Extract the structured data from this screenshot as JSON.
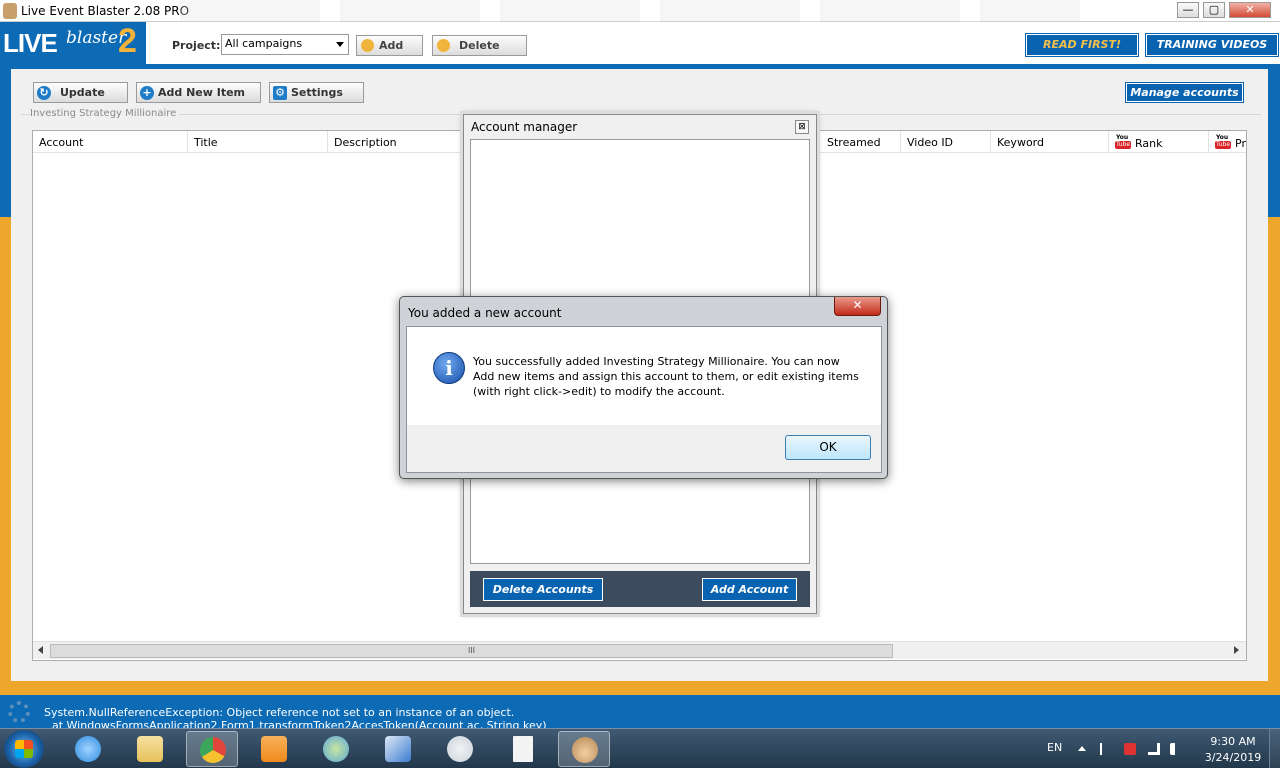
{
  "window": {
    "title": "Live Event Blaster 2.08 PRO",
    "controls": {
      "minimize": "—",
      "maximize": "▢",
      "close": "✕"
    }
  },
  "logo": {
    "live": "LIVE",
    "blaster": "blaster",
    "version": "2"
  },
  "header": {
    "project_label": "Project:",
    "project_value": "All campaigns",
    "add_label": "Add",
    "delete_label": "Delete",
    "read_first": "READ FIRST!",
    "training_videos": "TRAINING VIDEOS"
  },
  "toolbar": {
    "update_label": "Update",
    "add_new_item_label": "Add New Item",
    "settings_label": "Settings",
    "manage_accounts_label": "Manage accounts"
  },
  "group_label": "Investing Strategy Millionaire",
  "grid": {
    "columns": [
      "Account",
      "Title",
      "Description",
      "Streamed",
      "Video ID",
      "Keyword",
      "Rank",
      "Pr"
    ],
    "scroll_thumb_grip": "III",
    "youtube_icon": {
      "you": "You",
      "tube": "Tube"
    }
  },
  "account_manager": {
    "title": "Account manager",
    "close": "⊠",
    "delete_accounts": "Delete Accounts",
    "add_account": "Add Account"
  },
  "dialog": {
    "title": "You added a new account",
    "close": "✕",
    "icon": "i",
    "message_lines": [
      "You successfully added Investing Strategy Millionaire. You can now",
      "Add new items and assign this account to them, or edit existing items",
      "(with right click->edit) to modify the account."
    ],
    "ok_label": "OK"
  },
  "status": {
    "line1": "System.NullReferenceException: Object reference not set to an instance of an object.",
    "line2": "at WindowsFormsApplication2.Form1.transformToken2AccesToken(Account ac, String key)"
  },
  "taskbar": {
    "apps": [
      {
        "name": "internet-explorer",
        "color": "#2f8de0"
      },
      {
        "name": "file-explorer",
        "color": "#e7c25a"
      },
      {
        "name": "chrome",
        "color": "#e2463b"
      },
      {
        "name": "media-player",
        "color": "#f08a1c"
      },
      {
        "name": "people-network",
        "color": "#5fa8d8"
      },
      {
        "name": "remote-desktop",
        "color": "#3b7bd1"
      },
      {
        "name": "snipping-tool",
        "color": "#c9d3dc"
      },
      {
        "name": "blank-document",
        "color": "#f4f4f4"
      },
      {
        "name": "live-event-blaster",
        "color": "#e0b27a"
      }
    ],
    "language": "EN",
    "time": "9:30 AM",
    "date": "3/24/2019"
  }
}
